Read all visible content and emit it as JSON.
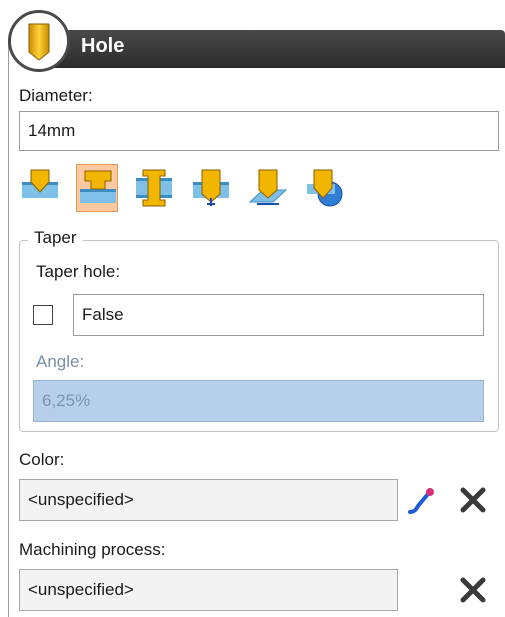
{
  "header": {
    "title": "Hole"
  },
  "diameter": {
    "label": "Diameter:",
    "value": "14mm"
  },
  "hole_types": [
    "simple",
    "counterbore",
    "countersink-both",
    "tapped",
    "blind-angled",
    "sphere-end"
  ],
  "taper": {
    "legend": "Taper",
    "hole_label": "Taper hole:",
    "hole_checked": false,
    "hole_value": "False",
    "angle_label": "Angle:",
    "angle_value": "6,25%"
  },
  "color": {
    "label": "Color:",
    "value": "<unspecified>"
  },
  "machining": {
    "label": "Machining process:",
    "value": "<unspecified>"
  },
  "colors": {
    "header_bar": "#2a2a2a",
    "selected_fill": "#fbc9a0",
    "disabled_fill": "#b6d0ec",
    "accent_gold": "#f2b600"
  }
}
